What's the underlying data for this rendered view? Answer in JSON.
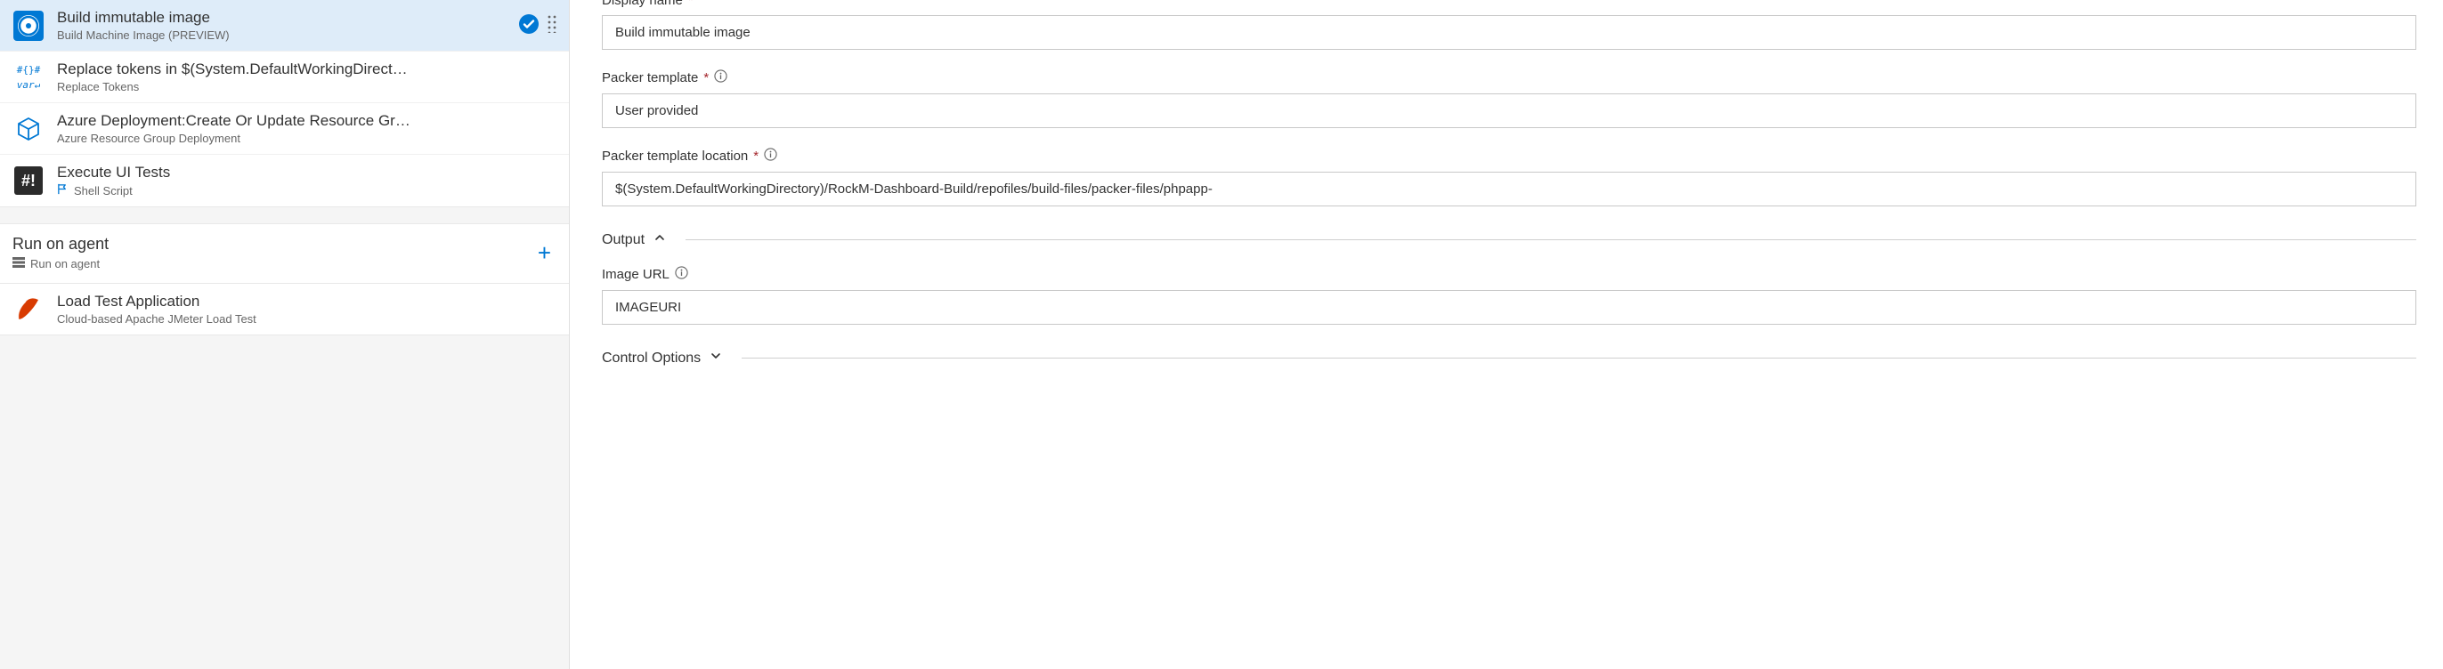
{
  "tasks": [
    {
      "title": "Build immutable image",
      "subtitle": "Build Machine Image (PREVIEW)",
      "selected": true
    },
    {
      "title": "Replace tokens in $(System.DefaultWorkingDirect…",
      "subtitle": "Replace Tokens",
      "selected": false
    },
    {
      "title": "Azure Deployment:Create Or Update Resource Gr…",
      "subtitle": "Azure Resource Group Deployment",
      "selected": false
    },
    {
      "title": "Execute UI Tests",
      "subtitle": "Shell Script",
      "selected": false
    }
  ],
  "agent": {
    "title": "Run on agent",
    "subtitle": "Run on agent"
  },
  "loadtest": {
    "title": "Load Test Application",
    "subtitle": "Cloud-based Apache JMeter Load Test"
  },
  "form": {
    "displayName": {
      "label": "Display name",
      "value": "Build immutable image",
      "required": true
    },
    "packerTemplate": {
      "label": "Packer template",
      "value": "User provided",
      "required": true
    },
    "packerTemplateLocation": {
      "label": "Packer template location",
      "value": "$(System.DefaultWorkingDirectory)/RockM-Dashboard-Build/repofiles/build-files/packer-files/phpapp-",
      "required": true
    },
    "imageUrl": {
      "label": "Image URL",
      "value": "IMAGEURI",
      "required": false
    }
  },
  "sections": {
    "output": "Output",
    "controlOptions": "Control Options"
  }
}
